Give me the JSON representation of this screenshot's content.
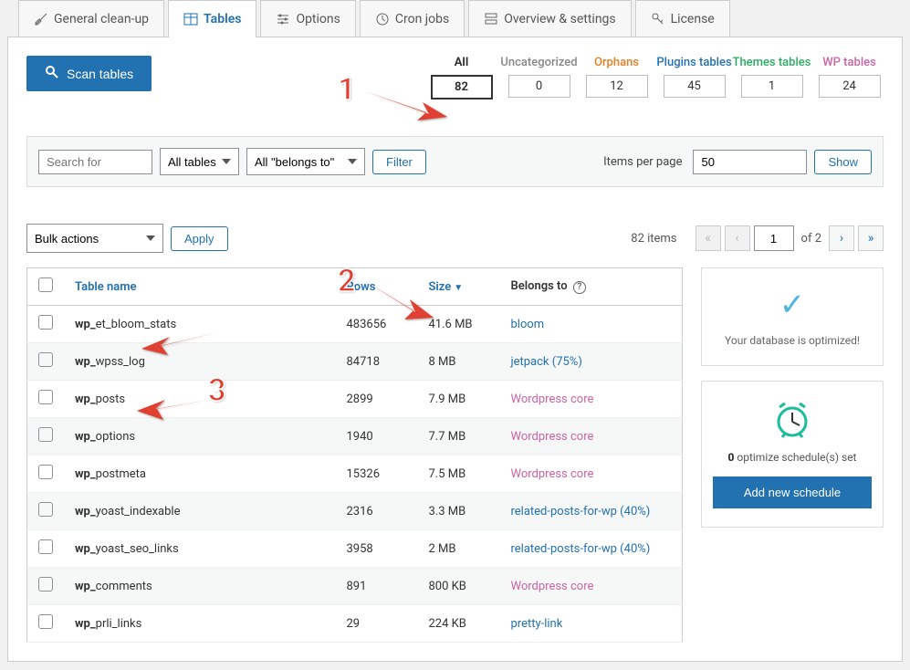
{
  "tabs": [
    {
      "label": "General clean-up"
    },
    {
      "label": "Tables"
    },
    {
      "label": "Options"
    },
    {
      "label": "Cron jobs"
    },
    {
      "label": "Overview & settings"
    },
    {
      "label": "License"
    }
  ],
  "scan_button": "Scan tables",
  "categories": [
    {
      "label": "All",
      "count": "82",
      "color": "#333",
      "active": true
    },
    {
      "label": "Uncategorized",
      "count": "0",
      "color": "#888"
    },
    {
      "label": "Orphans",
      "count": "12",
      "color": "#e67e22"
    },
    {
      "label": "Plugins tables",
      "count": "45",
      "color": "#2271b1"
    },
    {
      "label": "Themes tables",
      "count": "1",
      "color": "#27ae60"
    },
    {
      "label": "WP tables",
      "count": "24",
      "color": "#c964a4"
    }
  ],
  "filter": {
    "search_placeholder": "Search for",
    "all_tables": "All tables",
    "all_belongs": "All \"belongs to\"",
    "filter_btn": "Filter",
    "ipp_label": "Items per page",
    "ipp_value": "50",
    "show_btn": "Show"
  },
  "bulk": {
    "actions": "Bulk actions",
    "apply": "Apply",
    "items": "82 items",
    "cur_page": "1",
    "total_pages_label": "of 2"
  },
  "table_headers": {
    "name": "Table name",
    "rows": "Rows",
    "size": "Size",
    "belongs": "Belongs to"
  },
  "rows": [
    {
      "prefix": "wp_",
      "name": "et_bloom_stats",
      "rows": "483656",
      "size": "41.6 MB",
      "belongs": "bloom",
      "link": true
    },
    {
      "prefix": "wp_",
      "name": "wpss_log",
      "rows": "84718",
      "size": "8 MB",
      "belongs": "jetpack (75%)",
      "link": true
    },
    {
      "prefix": "wp_",
      "name": "posts",
      "rows": "2899",
      "size": "7.9 MB",
      "belongs": "Wordpress core",
      "link": false
    },
    {
      "prefix": "wp_",
      "name": "options",
      "rows": "1940",
      "size": "7.7 MB",
      "belongs": "Wordpress core",
      "link": false
    },
    {
      "prefix": "wp_",
      "name": "postmeta",
      "rows": "15326",
      "size": "7.5 MB",
      "belongs": "Wordpress core",
      "link": false
    },
    {
      "prefix": "wp_",
      "name": "yoast_indexable",
      "rows": "2316",
      "size": "3.3 MB",
      "belongs": "related-posts-for-wp (40%)",
      "link": true
    },
    {
      "prefix": "wp_",
      "name": "yoast_seo_links",
      "rows": "3958",
      "size": "2 MB",
      "belongs": "related-posts-for-wp (40%)",
      "link": true
    },
    {
      "prefix": "wp_",
      "name": "comments",
      "rows": "891",
      "size": "800 KB",
      "belongs": "Wordpress core",
      "link": false
    },
    {
      "prefix": "wp_",
      "name": "prli_links",
      "rows": "29",
      "size": "224 KB",
      "belongs": "pretty-link",
      "link": true
    }
  ],
  "sidebar": {
    "optimized": "Your database is optimized!",
    "sched_count": "0",
    "sched_text": " optimize schedule(s) set",
    "add_sched": "Add new schedule"
  }
}
